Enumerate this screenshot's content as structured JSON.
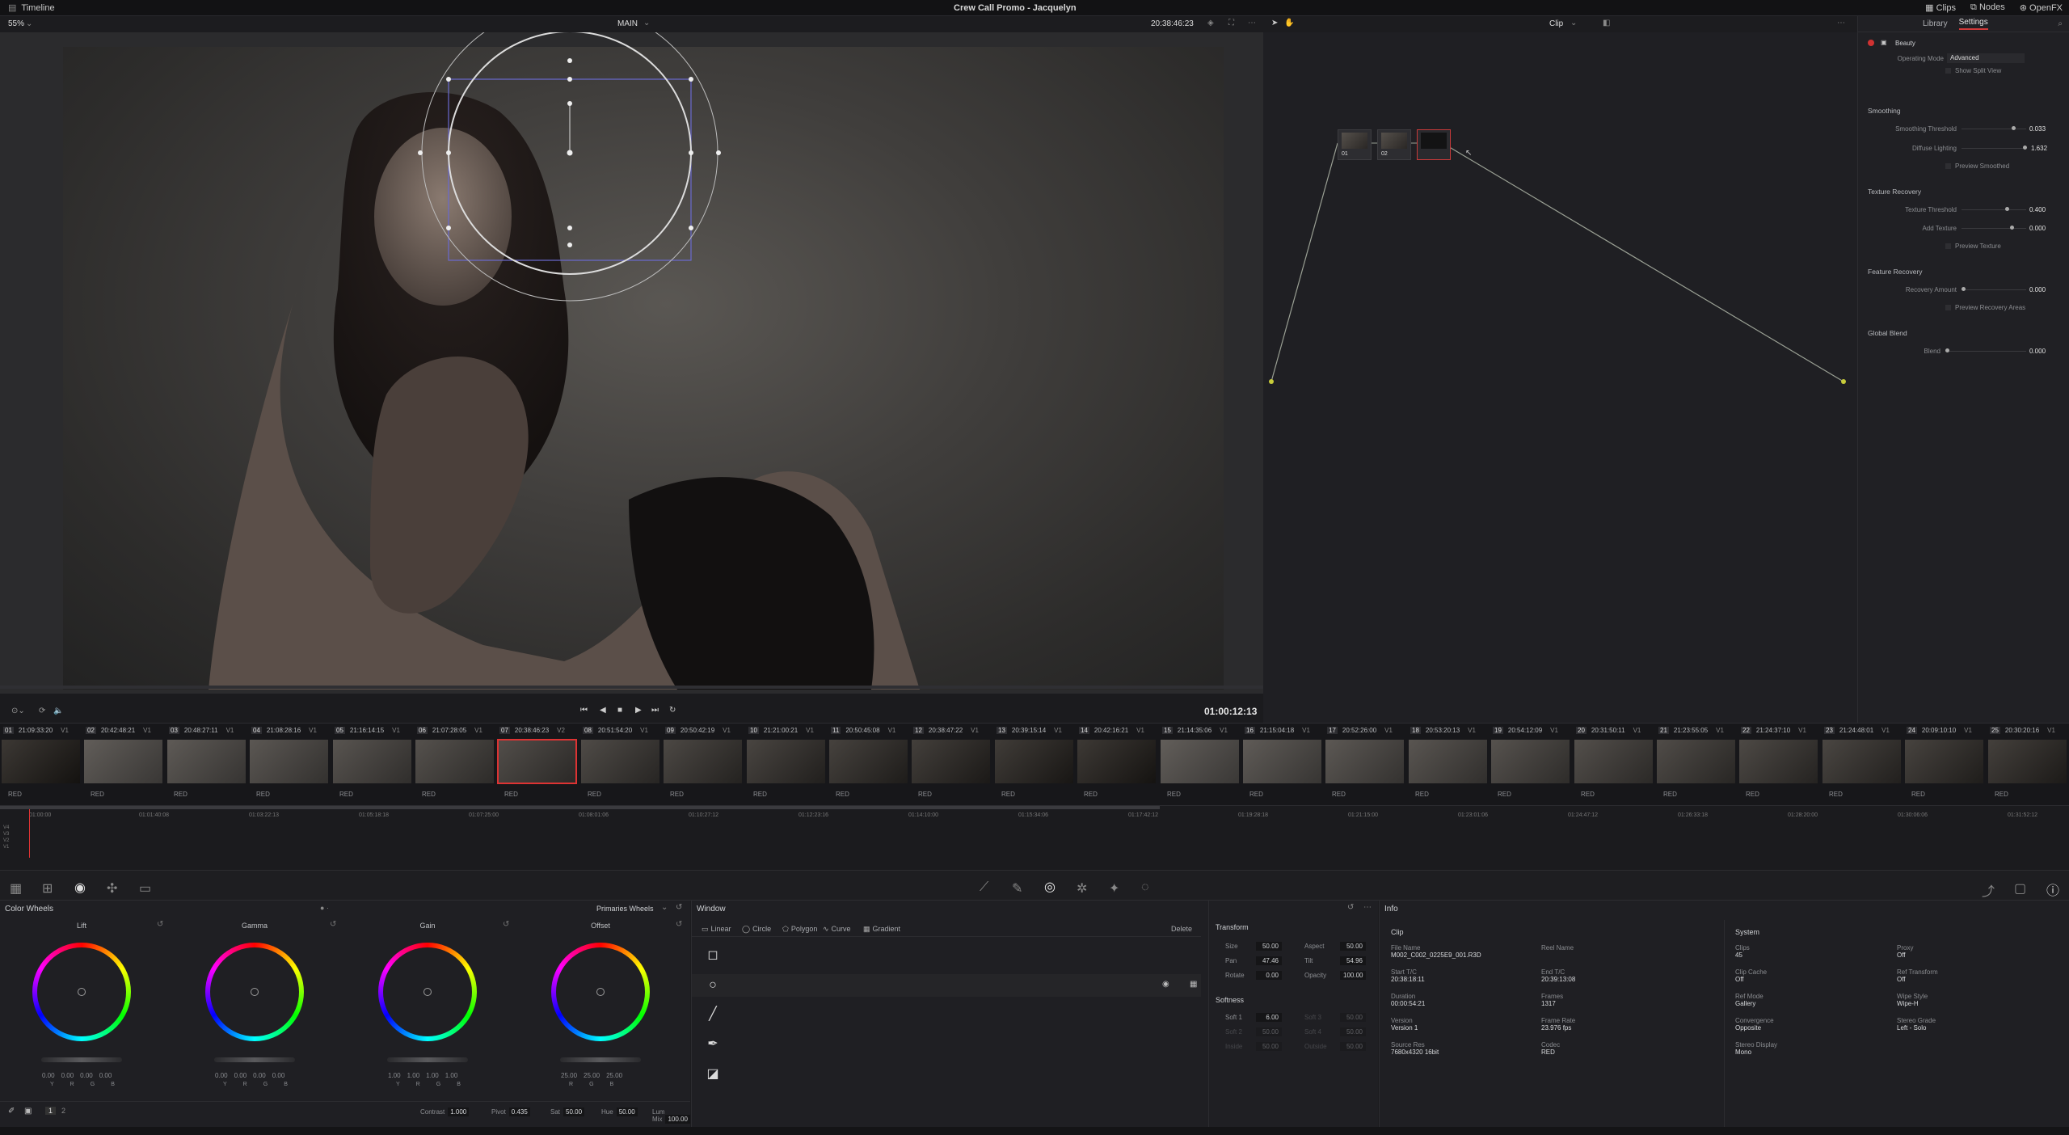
{
  "topbar": {
    "left_label": "Timeline",
    "title": "Crew Call Promo - Jacquelyn",
    "clips": "Clips",
    "nodes": "Nodes",
    "openfx": "OpenFX"
  },
  "viewer": {
    "zoom": "55%",
    "viewer_mode": "MAIN",
    "src_timecode": "20:38:46:23",
    "rec_timecode": "01:00:12:13"
  },
  "node_editor": {
    "mode": "Clip",
    "nodes": [
      {
        "label": "01"
      },
      {
        "label": "02"
      }
    ]
  },
  "settings": {
    "tabs": [
      "Library",
      "Settings"
    ],
    "active_tab": "Settings",
    "effect": "Beauty",
    "operating_mode_label": "Operating Mode",
    "operating_mode_value": "Advanced",
    "show_split_view": "Show Split View",
    "sections": [
      {
        "title": "Smoothing",
        "rows": [
          {
            "label": "Smoothing Threshold",
            "value": "0.033"
          },
          {
            "label": "Diffuse Lighting",
            "value": "1.632"
          },
          {
            "label": "Preview Smoothed",
            "value": ""
          }
        ]
      },
      {
        "title": "Texture Recovery",
        "rows": [
          {
            "label": "Texture Threshold",
            "value": "0.400"
          },
          {
            "label": "Add Texture",
            "value": "0.000"
          },
          {
            "label": "Preview Texture",
            "value": ""
          }
        ]
      },
      {
        "title": "Feature Recovery",
        "rows": [
          {
            "label": "Recovery Amount",
            "value": "0.000"
          },
          {
            "label": "Preview Recovery Areas",
            "value": ""
          }
        ]
      },
      {
        "title": "Global Blend",
        "rows": [
          {
            "label": "Blend",
            "value": "0.000"
          }
        ]
      }
    ]
  },
  "clips": [
    {
      "num": "01",
      "tc": "21:09:33:20",
      "track": "V1",
      "codec": "RED"
    },
    {
      "num": "02",
      "tc": "20:42:48:21",
      "track": "V1",
      "codec": "RED"
    },
    {
      "num": "03",
      "tc": "20:48:27:11",
      "track": "V1",
      "codec": "RED"
    },
    {
      "num": "04",
      "tc": "21:08:28:16",
      "track": "V1",
      "codec": "RED"
    },
    {
      "num": "05",
      "tc": "21:16:14:15",
      "track": "V1",
      "codec": "RED"
    },
    {
      "num": "06",
      "tc": "21:07:28:05",
      "track": "V1",
      "codec": "RED"
    },
    {
      "num": "07",
      "tc": "20:38:46:23",
      "track": "V2",
      "codec": "RED"
    },
    {
      "num": "08",
      "tc": "20:51:54:20",
      "track": "V1",
      "codec": "RED"
    },
    {
      "num": "09",
      "tc": "20:50:42:19",
      "track": "V1",
      "codec": "RED"
    },
    {
      "num": "10",
      "tc": "21:21:00:21",
      "track": "V1",
      "codec": "RED"
    },
    {
      "num": "11",
      "tc": "20:50:45:08",
      "track": "V1",
      "codec": "RED"
    },
    {
      "num": "12",
      "tc": "20:38:47:22",
      "track": "V1",
      "codec": "RED"
    },
    {
      "num": "13",
      "tc": "20:39:15:14",
      "track": "V1",
      "codec": "RED"
    },
    {
      "num": "14",
      "tc": "20:42:16:21",
      "track": "V1",
      "codec": "RED"
    },
    {
      "num": "15",
      "tc": "21:14:35:06",
      "track": "V1",
      "codec": "RED"
    },
    {
      "num": "16",
      "tc": "21:15:04:18",
      "track": "V1",
      "codec": "RED"
    },
    {
      "num": "17",
      "tc": "20:52:26:00",
      "track": "V1",
      "codec": "RED"
    },
    {
      "num": "18",
      "tc": "20:53:20:13",
      "track": "V1",
      "codec": "RED"
    },
    {
      "num": "19",
      "tc": "20:54:12:09",
      "track": "V1",
      "codec": "RED"
    },
    {
      "num": "20",
      "tc": "20:31:50:11",
      "track": "V1",
      "codec": "RED"
    },
    {
      "num": "21",
      "tc": "21:23:55:05",
      "track": "V1",
      "codec": "RED"
    },
    {
      "num": "22",
      "tc": "21:24:37:10",
      "track": "V1",
      "codec": "RED"
    },
    {
      "num": "23",
      "tc": "21:24:48:01",
      "track": "V1",
      "codec": "RED"
    },
    {
      "num": "24",
      "tc": "20:09:10:10",
      "track": "V1",
      "codec": "RED"
    },
    {
      "num": "25",
      "tc": "20:30:20:16",
      "track": "V1",
      "codec": "RED"
    }
  ],
  "color_wheels": {
    "title": "Color Wheels",
    "mode": "Primaries Wheels",
    "wheels": [
      {
        "name": "Lift",
        "values": [
          "0.00",
          "0.00",
          "0.00",
          "0.00"
        ],
        "channels": [
          "Y",
          "R",
          "G",
          "B"
        ]
      },
      {
        "name": "Gamma",
        "values": [
          "0.00",
          "0.00",
          "0.00",
          "0.00"
        ],
        "channels": [
          "Y",
          "R",
          "G",
          "B"
        ]
      },
      {
        "name": "Gain",
        "values": [
          "1.00",
          "1.00",
          "1.00",
          "1.00"
        ],
        "channels": [
          "Y",
          "R",
          "G",
          "B"
        ]
      },
      {
        "name": "Offset",
        "values": [
          "25.00",
          "25.00",
          "25.00"
        ],
        "channels": [
          "R",
          "G",
          "B"
        ]
      }
    ],
    "footer": [
      {
        "label": "Contrast",
        "value": "1.000"
      },
      {
        "label": "Pivot",
        "value": "0.435"
      },
      {
        "label": "Sat",
        "value": "50.00"
      },
      {
        "label": "Hue",
        "value": "50.00"
      },
      {
        "label": "Lum Mix",
        "value": "100.00"
      }
    ],
    "page_buttons": [
      "1",
      "2"
    ]
  },
  "window": {
    "title": "Window",
    "tools": [
      "Linear",
      "Circle",
      "Polygon",
      "Curve",
      "Gradient"
    ],
    "delete_label": "Delete"
  },
  "transform": {
    "title": "Transform",
    "size": "50.00",
    "aspect": "50.00",
    "pan": "47.46",
    "tilt": "54.96",
    "rotate": "0.00",
    "opacity": "100.00",
    "softness_title": "Softness",
    "soft1": "6.00",
    "soft2": "50.00",
    "soft3": "50.00",
    "soft4": "50.00",
    "inside": "50.00",
    "outside": "50.00"
  },
  "info_panel": {
    "title": "Info",
    "clip_header": "Clip",
    "system_header": "System",
    "clip": [
      {
        "k": "File Name",
        "v": "M002_C002_0225E9_001.R3D"
      },
      {
        "k": "Reel Name",
        "v": ""
      },
      {
        "k": "Start T/C",
        "v": "20:38:18:11"
      },
      {
        "k": "End T/C",
        "v": "20:39:13:08"
      },
      {
        "k": "Duration",
        "v": "00:00:54:21"
      },
      {
        "k": "Frames",
        "v": "1317"
      },
      {
        "k": "Version",
        "v": "Version 1"
      },
      {
        "k": "Frame Rate",
        "v": "23.976 fps"
      },
      {
        "k": "Source Res",
        "v": "7680x4320 16bit"
      },
      {
        "k": "Codec",
        "v": "RED"
      }
    ],
    "system": [
      {
        "k": "Clips",
        "v": "45"
      },
      {
        "k": "Proxy",
        "v": "Off"
      },
      {
        "k": "Clip Cache",
        "v": "Off"
      },
      {
        "k": "Ref Transform",
        "v": "Off"
      },
      {
        "k": "Ref Mode",
        "v": "Gallery"
      },
      {
        "k": "Wipe Style",
        "v": "Wipe-H"
      },
      {
        "k": "Convergence",
        "v": "Opposite"
      },
      {
        "k": "Stereo Grade",
        "v": "Left - Solo"
      },
      {
        "k": "Stereo Display",
        "v": "Mono"
      }
    ]
  },
  "timeline_ruler": [
    "01:00:00",
    "01:01:40:08",
    "01:03:22:13",
    "01:05:18:18",
    "01:07:25:00",
    "01:08:01:06",
    "01:10:27:12",
    "01:12:23:16",
    "01:14:10:00",
    "01:15:34:06",
    "01:17:42:12",
    "01:19:28:18",
    "01:21:15:00",
    "01:23:01:06",
    "01:24:47:12",
    "01:26:33:18",
    "01:28:20:00",
    "01:30:06:06",
    "01:31:52:12"
  ],
  "tracks": [
    "V4",
    "V3",
    "V2",
    "V1"
  ]
}
